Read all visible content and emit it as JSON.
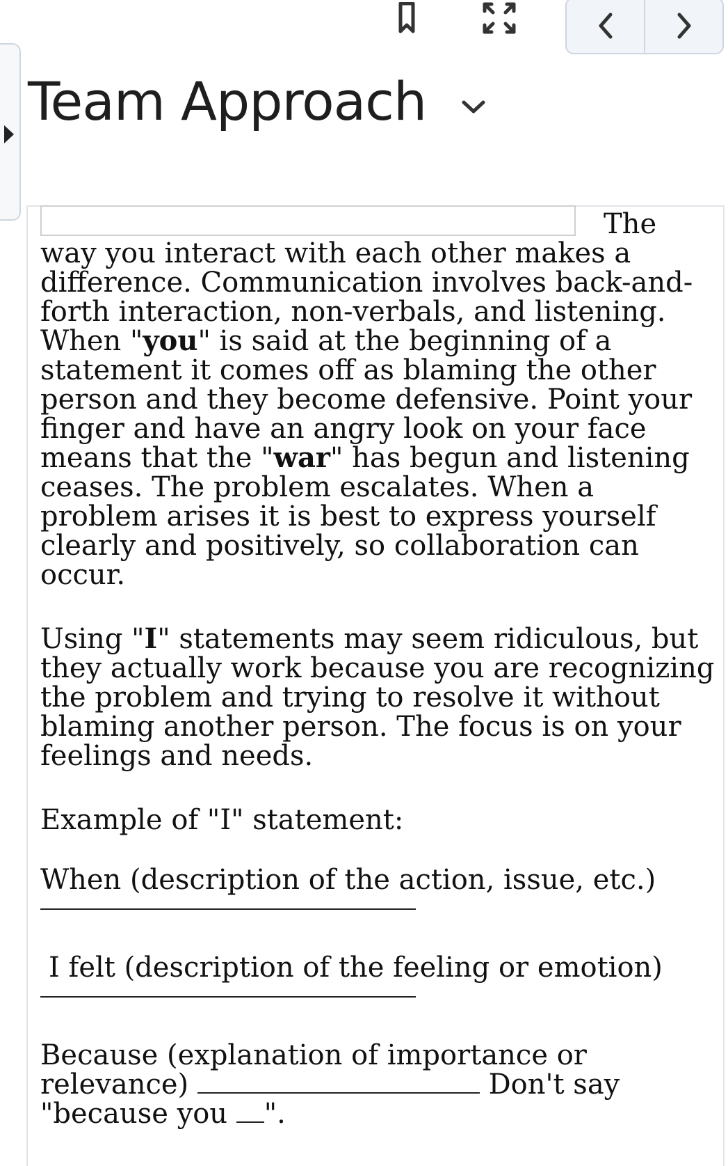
{
  "toolbar": {
    "bookmark_icon": "bookmark-icon",
    "fullscreen_icon": "expand-icon",
    "prev_icon": "chevron-left-icon",
    "next_icon": "chevron-right-icon"
  },
  "side_panel": {
    "toggle_icon": "caret-right-icon"
  },
  "header": {
    "title": "Team Approach",
    "menu_icon": "chevron-down-icon"
  },
  "content": {
    "intro_lead": "The way you interact with each other makes a difference. Communication involves back-and-forth interaction, non-verbals, and listening. When \"",
    "intro_bold_you": "you",
    "intro_mid": "\" is said at the beginning of a statement it comes off as blaming the other person and they become defensive. Point your finger and have an angry look on your face means that the \"",
    "intro_bold_war": "war",
    "intro_tail": "\" has begun and listening ceases. The problem escalates. When a problem arises it is best to express yourself clearly and positively, so collaboration can occur.",
    "i_lead": "Using \"",
    "i_bold": "I",
    "i_tail": "\" statements may seem ridiculous, but they actually work because you are recognizing the problem and trying to resolve it without blaming another person. The focus is on your feelings and needs.",
    "example_heading": "Example of \"I\" statement:",
    "when_line": "When (description of the action, issue, etc.)",
    "felt_line": "I felt (description of the feeling or emotion)",
    "because_lead": "Because (explanation of importance or relevance)",
    "because_tail": "Don't say \"because you",
    "because_end": "\"."
  },
  "colors": {
    "border": "#cfd6df",
    "nav_bg": "#f1f4f8",
    "text": "#111111"
  }
}
